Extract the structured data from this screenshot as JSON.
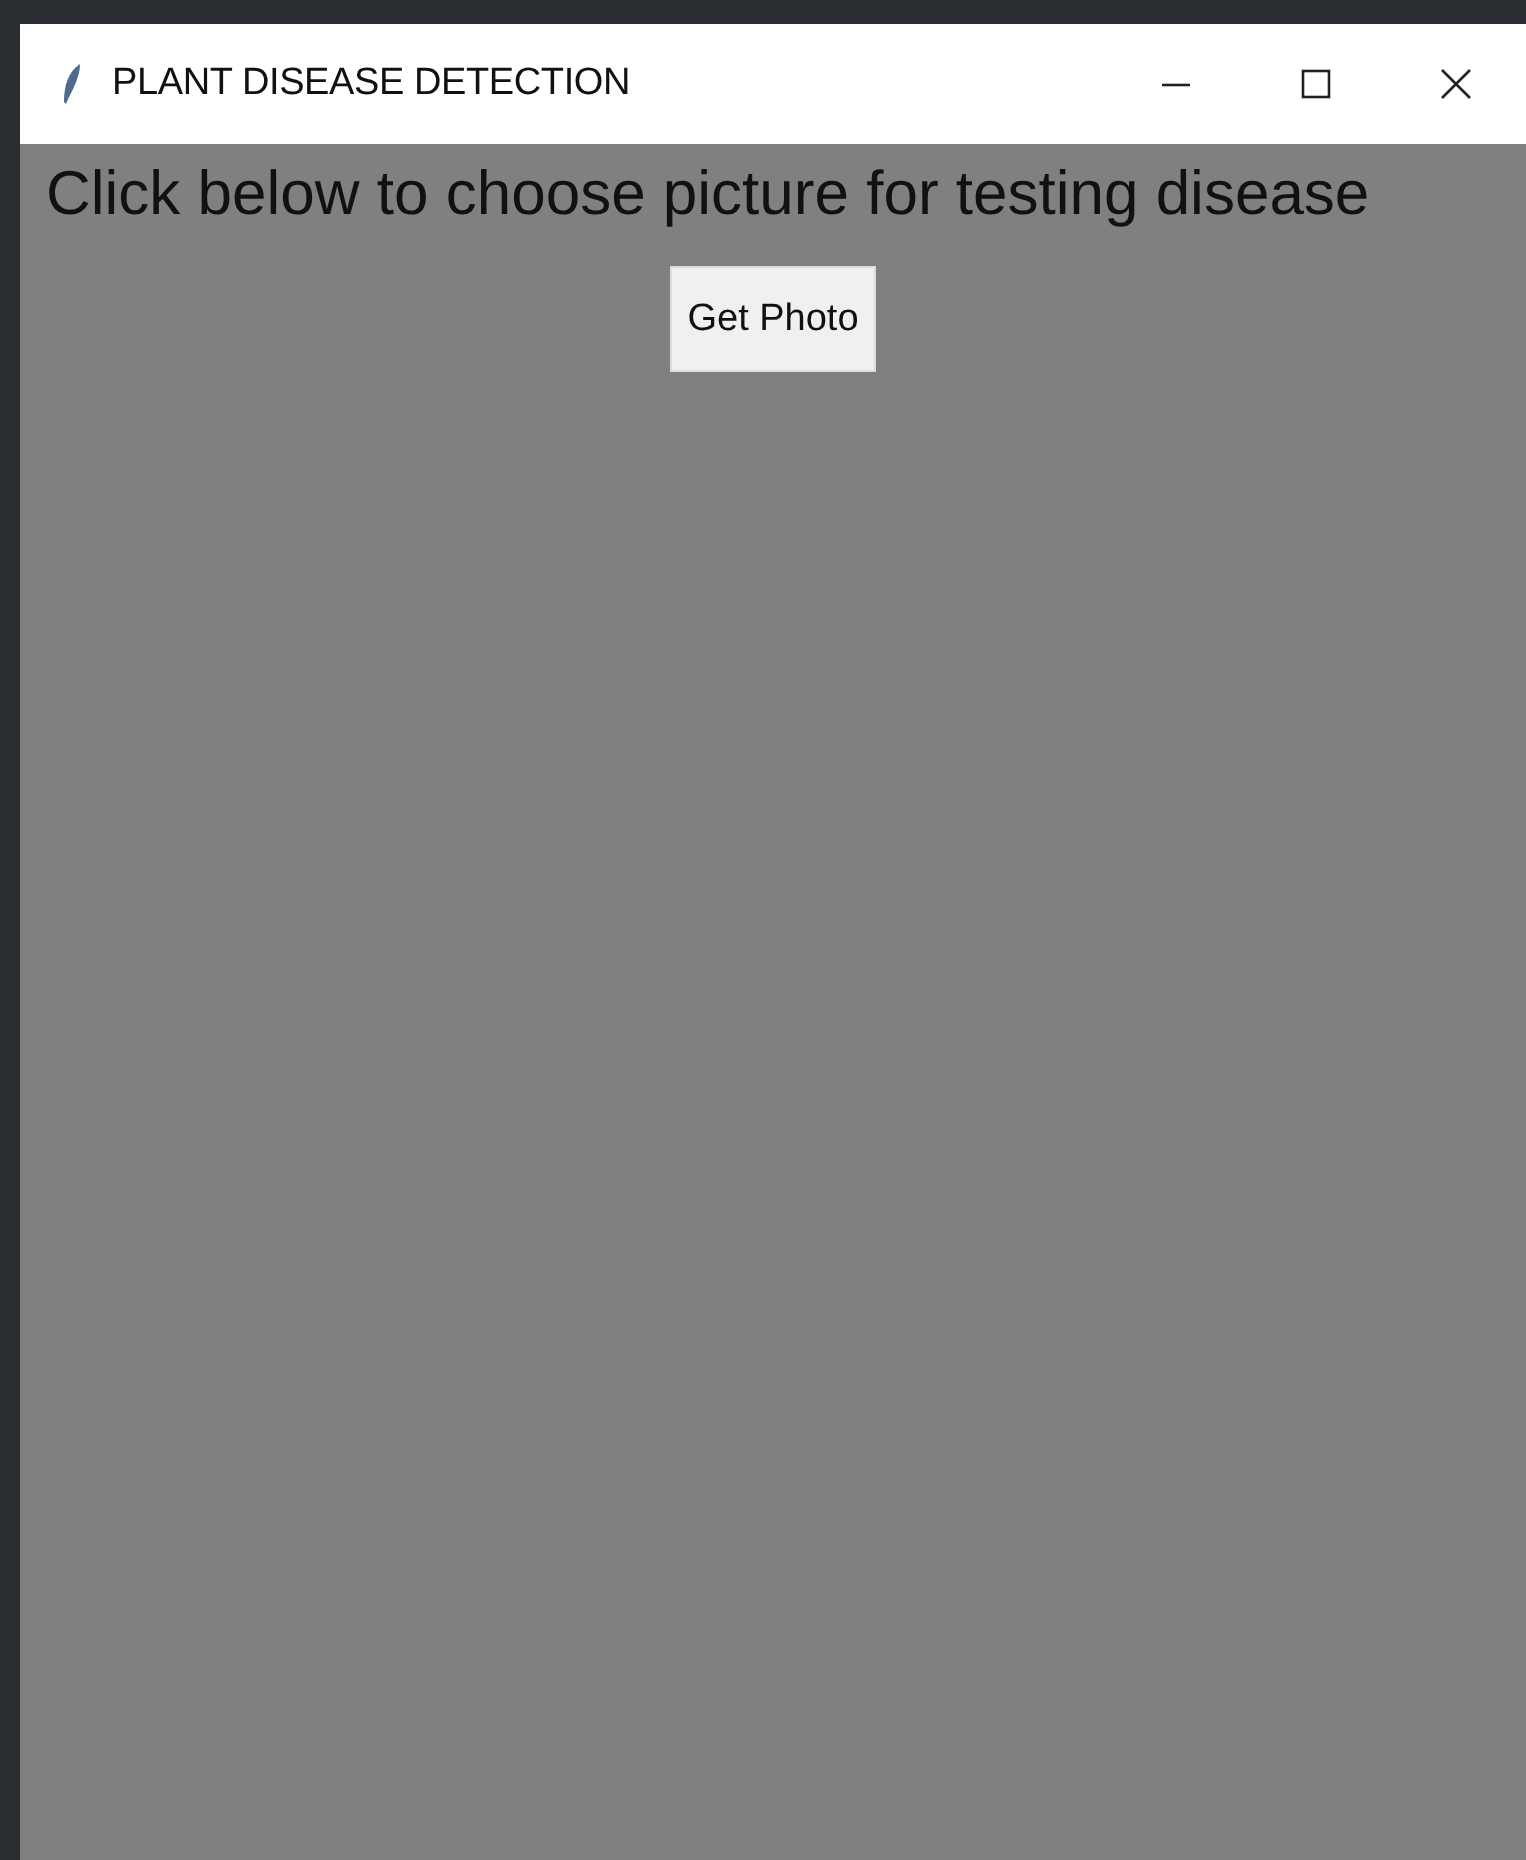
{
  "window": {
    "title": "PLANT DISEASE DETECTION"
  },
  "content": {
    "prompt": "Click below to choose picture for testing disease",
    "button": "Get Photo"
  }
}
